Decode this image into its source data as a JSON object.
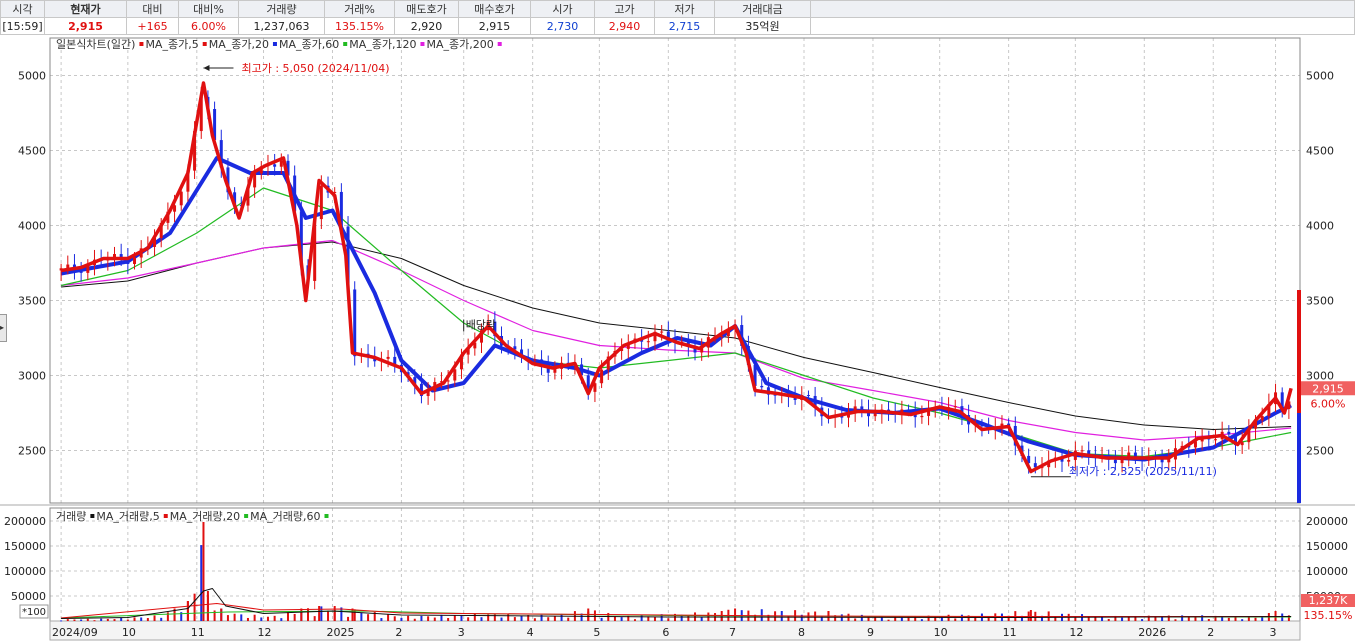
{
  "quote_bar": {
    "headers": [
      "시각",
      "현재가",
      "대비",
      "대비%",
      "거래량",
      "거래%",
      "매도호가",
      "매수호가",
      "시가",
      "고가",
      "저가",
      "거래대금"
    ],
    "values": [
      "[15:59]",
      "2,915",
      "+165",
      "6.00%",
      "1,237,063",
      "135.15%",
      "2,920",
      "2,915",
      "2,730",
      "2,940",
      "2,715",
      "35억원"
    ],
    "value_colors": [
      "#222",
      "#e01010",
      "#e01010",
      "#e01010",
      "#222",
      "#e01010",
      "#222",
      "#222",
      "#1040d0",
      "#e01010",
      "#1040d0",
      "#222"
    ]
  },
  "price_legend": [
    {
      "text": "일본식차트(일간)",
      "color": "#444"
    },
    {
      "text": "MA_종가,5",
      "color": "#e01010"
    },
    {
      "text": "MA_종가,20",
      "color": "#e01010"
    },
    {
      "text": "MA_종가,60",
      "color": "#1a2be0"
    },
    {
      "text": "MA_종가,120",
      "color": "#22bb22"
    },
    {
      "text": "MA_종가,200",
      "color": "#e020e0"
    }
  ],
  "volume_legend": [
    {
      "text": "거래량",
      "color": "#e01010"
    },
    {
      "text": "MA_거래량,5",
      "color": "#111111"
    },
    {
      "text": "MA_거래량,20",
      "color": "#e01010"
    },
    {
      "text": "MA_거래량,60",
      "color": "#22bb22"
    }
  ],
  "annotations": {
    "high": "최고가 : 5,050 (2024/11/04)",
    "low": "최저가 : 2,325 (2025/11/11)",
    "dividend": "배당락"
  },
  "badges": {
    "price": "2,915",
    "price_pct": "6.00%",
    "volume": "1,237K",
    "volume_pct": "135.15%",
    "volume_unit": "*100"
  },
  "colors": {
    "up": "#e01010",
    "down": "#1a2be0",
    "ma5": "#e01010",
    "ma20": "#e01010",
    "ma60": "#1a2be0",
    "ma120": "#22bb22",
    "ma200": "#e020e0",
    "ma200_alt": "#111111",
    "vol_ma5": "#111111",
    "vol_ma20": "#e01010",
    "vol_ma60": "#22bb22"
  },
  "chart_data": {
    "type": "candlestick",
    "title": "일본식차트(일간)",
    "price_axis": {
      "ticks": [
        2500,
        3000,
        3500,
        4000,
        4500,
        5000
      ],
      "ylim": [
        2150,
        5250
      ]
    },
    "volume_axis": {
      "ticks": [
        50000,
        100000,
        150000,
        200000
      ],
      "ylim": [
        0,
        210000
      ]
    },
    "x_ticks": [
      "2024/09",
      "10",
      "11",
      "12",
      "2025",
      "2",
      "3",
      "4",
      "5",
      "6",
      "7",
      "8",
      "9",
      "10",
      "11",
      "12",
      "2026",
      "2",
      "3"
    ],
    "grid": true,
    "series": {
      "price_close": [
        [
          "2024-09-01",
          3700
        ],
        [
          "2024-09-10",
          3720
        ],
        [
          "2024-09-20",
          3780
        ],
        [
          "2024-10-01",
          3780
        ],
        [
          "2024-10-10",
          3850
        ],
        [
          "2024-10-20",
          4100
        ],
        [
          "2024-10-28",
          4350
        ],
        [
          "2024-11-04",
          4950
        ],
        [
          "2024-11-08",
          4600
        ],
        [
          "2024-11-14",
          4300
        ],
        [
          "2024-11-20",
          4050
        ],
        [
          "2024-11-26",
          4350
        ],
        [
          "2024-12-02",
          4400
        ],
        [
          "2024-12-10",
          4450
        ],
        [
          "2024-12-16",
          4000
        ],
        [
          "2024-12-20",
          3500
        ],
        [
          "2024-12-26",
          4300
        ],
        [
          "2025-01-02",
          4200
        ],
        [
          "2025-01-07",
          3800
        ],
        [
          "2025-01-10",
          3150
        ],
        [
          "2025-01-20",
          3120
        ],
        [
          "2025-02-01",
          3050
        ],
        [
          "2025-02-10",
          2880
        ],
        [
          "2025-02-20",
          2950
        ],
        [
          "2025-03-01",
          3150
        ],
        [
          "2025-03-12",
          3330
        ],
        [
          "2025-03-20",
          3200
        ],
        [
          "2025-04-01",
          3080
        ],
        [
          "2025-04-10",
          3050
        ],
        [
          "2025-04-20",
          3080
        ],
        [
          "2025-04-26",
          2880
        ],
        [
          "2025-05-01",
          3050
        ],
        [
          "2025-05-12",
          3200
        ],
        [
          "2025-05-26",
          3280
        ],
        [
          "2025-06-05",
          3220
        ],
        [
          "2025-06-15",
          3180
        ],
        [
          "2025-06-25",
          3280
        ],
        [
          "2025-07-01",
          3330
        ],
        [
          "2025-07-06",
          3150
        ],
        [
          "2025-07-10",
          2900
        ],
        [
          "2025-07-20",
          2880
        ],
        [
          "2025-08-01",
          2850
        ],
        [
          "2025-08-12",
          2720
        ],
        [
          "2025-08-25",
          2760
        ],
        [
          "2025-09-05",
          2760
        ],
        [
          "2025-09-18",
          2740
        ],
        [
          "2025-10-01",
          2790
        ],
        [
          "2025-10-10",
          2760
        ],
        [
          "2025-10-20",
          2640
        ],
        [
          "2025-11-01",
          2660
        ],
        [
          "2025-11-11",
          2360
        ],
        [
          "2025-11-20",
          2430
        ],
        [
          "2025-12-01",
          2480
        ],
        [
          "2025-12-15",
          2450
        ],
        [
          "2026-01-01",
          2450
        ],
        [
          "2026-01-12",
          2450
        ],
        [
          "2026-01-25",
          2580
        ],
        [
          "2026-02-05",
          2600
        ],
        [
          "2026-02-12",
          2540
        ],
        [
          "2026-02-20",
          2700
        ],
        [
          "2026-03-01",
          2850
        ],
        [
          "2026-03-05",
          2750
        ],
        [
          "2026-03-08",
          2915
        ]
      ],
      "ma60": [
        [
          "2024-09-01",
          3680
        ],
        [
          "2024-10-01",
          3760
        ],
        [
          "2024-10-20",
          3950
        ],
        [
          "2024-11-10",
          4450
        ],
        [
          "2024-11-25",
          4350
        ],
        [
          "2024-12-10",
          4350
        ],
        [
          "2024-12-20",
          4050
        ],
        [
          "2025-01-01",
          4100
        ],
        [
          "2025-01-20",
          3550
        ],
        [
          "2025-02-01",
          3100
        ],
        [
          "2025-02-15",
          2900
        ],
        [
          "2025-03-01",
          2950
        ],
        [
          "2025-03-15",
          3200
        ],
        [
          "2025-04-01",
          3100
        ],
        [
          "2025-04-20",
          3050
        ],
        [
          "2025-05-01",
          3000
        ],
        [
          "2025-05-20",
          3150
        ],
        [
          "2025-06-05",
          3250
        ],
        [
          "2025-06-20",
          3200
        ],
        [
          "2025-07-01",
          3330
        ],
        [
          "2025-07-15",
          2950
        ],
        [
          "2025-08-01",
          2850
        ],
        [
          "2025-08-20",
          2770
        ],
        [
          "2025-09-10",
          2750
        ],
        [
          "2025-10-01",
          2780
        ],
        [
          "2025-10-20",
          2680
        ],
        [
          "2025-11-10",
          2560
        ],
        [
          "2025-12-01",
          2470
        ],
        [
          "2026-01-01",
          2440
        ],
        [
          "2026-02-01",
          2520
        ],
        [
          "2026-03-01",
          2750
        ],
        [
          "2026-03-08",
          2800
        ]
      ],
      "ma120": [
        [
          "2024-09-01",
          3600
        ],
        [
          "2024-10-01",
          3700
        ],
        [
          "2024-11-01",
          3950
        ],
        [
          "2024-12-01",
          4250
        ],
        [
          "2025-01-01",
          4100
        ],
        [
          "2025-02-01",
          3700
        ],
        [
          "2025-03-01",
          3350
        ],
        [
          "2025-04-01",
          3100
        ],
        [
          "2025-05-01",
          3050
        ],
        [
          "2025-06-01",
          3100
        ],
        [
          "2025-07-01",
          3150
        ],
        [
          "2025-08-01",
          3000
        ],
        [
          "2025-09-01",
          2850
        ],
        [
          "2025-10-01",
          2750
        ],
        [
          "2025-11-01",
          2620
        ],
        [
          "2025-12-01",
          2480
        ],
        [
          "2026-01-01",
          2460
        ],
        [
          "2026-02-01",
          2520
        ],
        [
          "2026-03-08",
          2620
        ]
      ],
      "ma200": [
        [
          "2024-09-01",
          3600
        ],
        [
          "2024-10-01",
          3650
        ],
        [
          "2024-11-01",
          3750
        ],
        [
          "2024-12-01",
          3850
        ],
        [
          "2025-01-01",
          3900
        ],
        [
          "2025-02-01",
          3700
        ],
        [
          "2025-03-01",
          3500
        ],
        [
          "2025-04-01",
          3300
        ],
        [
          "2025-05-01",
          3200
        ],
        [
          "2025-06-01",
          3170
        ],
        [
          "2025-07-01",
          3150
        ],
        [
          "2025-08-01",
          2980
        ],
        [
          "2025-09-01",
          2900
        ],
        [
          "2025-10-01",
          2820
        ],
        [
          "2025-11-01",
          2700
        ],
        [
          "2025-12-01",
          2620
        ],
        [
          "2026-01-01",
          2570
        ],
        [
          "2026-02-01",
          2600
        ],
        [
          "2026-03-08",
          2650
        ]
      ],
      "ma240": [
        [
          "2024-09-01",
          3590
        ],
        [
          "2024-10-01",
          3630
        ],
        [
          "2024-11-01",
          3750
        ],
        [
          "2024-12-01",
          3850
        ],
        [
          "2025-01-01",
          3890
        ],
        [
          "2025-02-01",
          3780
        ],
        [
          "2025-03-01",
          3600
        ],
        [
          "2025-04-01",
          3450
        ],
        [
          "2025-05-01",
          3350
        ],
        [
          "2025-06-01",
          3300
        ],
        [
          "2025-07-01",
          3250
        ],
        [
          "2025-08-01",
          3120
        ],
        [
          "2025-09-01",
          3020
        ],
        [
          "2025-10-01",
          2920
        ],
        [
          "2025-11-01",
          2820
        ],
        [
          "2025-12-01",
          2730
        ],
        [
          "2026-01-01",
          2670
        ],
        [
          "2026-02-01",
          2640
        ],
        [
          "2026-03-08",
          2660
        ]
      ],
      "volume": [
        [
          "2024-09-05",
          4000
        ],
        [
          "2024-09-20",
          5000
        ],
        [
          "2024-10-05",
          8000
        ],
        [
          "2024-10-15",
          12000
        ],
        [
          "2024-10-22",
          25000
        ],
        [
          "2024-10-28",
          40000
        ],
        [
          "2024-11-04",
          198000
        ],
        [
          "2024-11-06",
          60000
        ],
        [
          "2024-11-12",
          25000
        ],
        [
          "2024-11-20",
          15000
        ],
        [
          "2024-12-05",
          10000
        ],
        [
          "2024-12-18",
          25000
        ],
        [
          "2024-12-26",
          30000
        ],
        [
          "2025-01-02",
          30000
        ],
        [
          "2025-01-10",
          25000
        ],
        [
          "2025-02-01",
          10000
        ],
        [
          "2025-03-12",
          15000
        ],
        [
          "2025-04-10",
          12000
        ],
        [
          "2025-04-26",
          25000
        ],
        [
          "2025-05-12",
          10000
        ],
        [
          "2025-06-25",
          20000
        ],
        [
          "2025-07-01",
          25000
        ],
        [
          "2025-08-12",
          20000
        ],
        [
          "2025-09-05",
          8000
        ],
        [
          "2025-10-20",
          15000
        ],
        [
          "2025-11-11",
          22000
        ],
        [
          "2025-12-15",
          10000
        ],
        [
          "2026-01-25",
          12000
        ],
        [
          "2026-02-20",
          8000
        ],
        [
          "2026-03-01",
          20000
        ],
        [
          "2026-03-08",
          12370
        ]
      ],
      "volume_ma5": [
        [
          "2024-09-01",
          5000
        ],
        [
          "2024-10-01",
          7000
        ],
        [
          "2024-10-28",
          25000
        ],
        [
          "2024-11-04",
          60000
        ],
        [
          "2024-11-08",
          65000
        ],
        [
          "2024-11-14",
          30000
        ],
        [
          "2024-12-01",
          15000
        ],
        [
          "2025-01-01",
          20000
        ],
        [
          "2025-02-01",
          12000
        ],
        [
          "2025-06-01",
          8000
        ],
        [
          "2025-11-01",
          7000
        ],
        [
          "2026-03-08",
          9000
        ]
      ],
      "volume_ma20": [
        [
          "2024-09-01",
          6000
        ],
        [
          "2024-11-10",
          35000
        ],
        [
          "2024-12-01",
          22000
        ],
        [
          "2025-01-05",
          24000
        ],
        [
          "2025-02-01",
          16000
        ],
        [
          "2025-04-01",
          14000
        ],
        [
          "2025-06-01",
          12000
        ],
        [
          "2025-08-01",
          10000
        ],
        [
          "2025-11-01",
          9000
        ],
        [
          "2026-03-08",
          9000
        ]
      ],
      "volume_ma60": [
        [
          "2024-09-01",
          6000
        ],
        [
          "2024-11-15",
          18000
        ],
        [
          "2025-01-15",
          20000
        ],
        [
          "2025-03-01",
          15000
        ],
        [
          "2025-06-01",
          11000
        ],
        [
          "2025-09-01",
          9000
        ],
        [
          "2026-03-08",
          8000
        ]
      ]
    }
  }
}
